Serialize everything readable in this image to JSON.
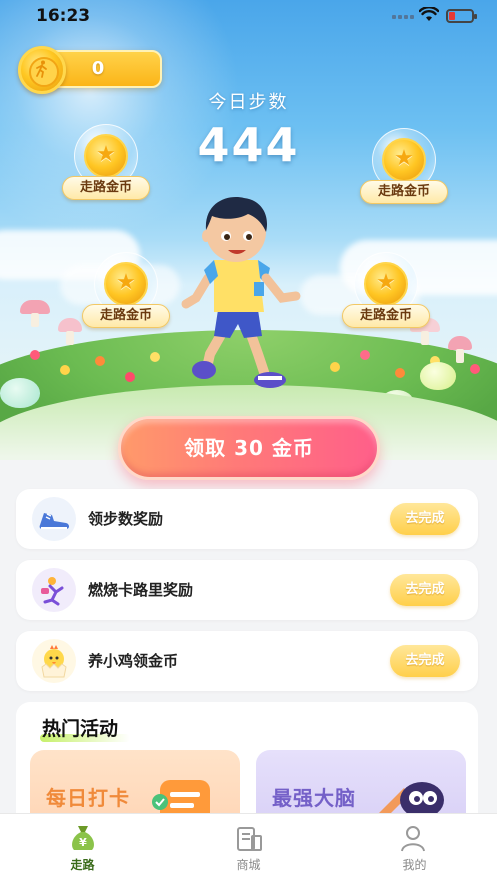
{
  "status_bar": {
    "time": "16:23"
  },
  "coin_balance": {
    "value": "0"
  },
  "steps": {
    "label": "今日步数",
    "value": "444"
  },
  "bubbles": [
    {
      "label": "走路金币"
    },
    {
      "label": "走路金币"
    },
    {
      "label": "走路金币"
    },
    {
      "label": "走路金币"
    }
  ],
  "claim_button": {
    "label": "领取 30 金币"
  },
  "tasks": [
    {
      "label": "领步数奖励",
      "button": "去完成",
      "icon": "sneaker-icon"
    },
    {
      "label": "燃烧卡路里奖励",
      "button": "去完成",
      "icon": "exercise-icon"
    },
    {
      "label": "养小鸡领金币",
      "button": "去完成",
      "icon": "chick-icon"
    }
  ],
  "hot_activities": {
    "title": "热门活动",
    "items": [
      {
        "label": "每日打卡",
        "icon": "checklist-icon",
        "color": "#f08a3a"
      },
      {
        "label": "最强大脑",
        "icon": "brain-icon",
        "color": "#7460c8"
      }
    ]
  },
  "tab_bar": {
    "items": [
      {
        "label": "走路",
        "icon": "money-bag-icon",
        "active": true
      },
      {
        "label": "商城",
        "icon": "store-icon",
        "active": false
      },
      {
        "label": "我的",
        "icon": "profile-icon",
        "active": false
      }
    ]
  },
  "colors": {
    "accent": "#ff6f80",
    "gold": "#ffc623",
    "tab_active": "#3a6b1a"
  }
}
